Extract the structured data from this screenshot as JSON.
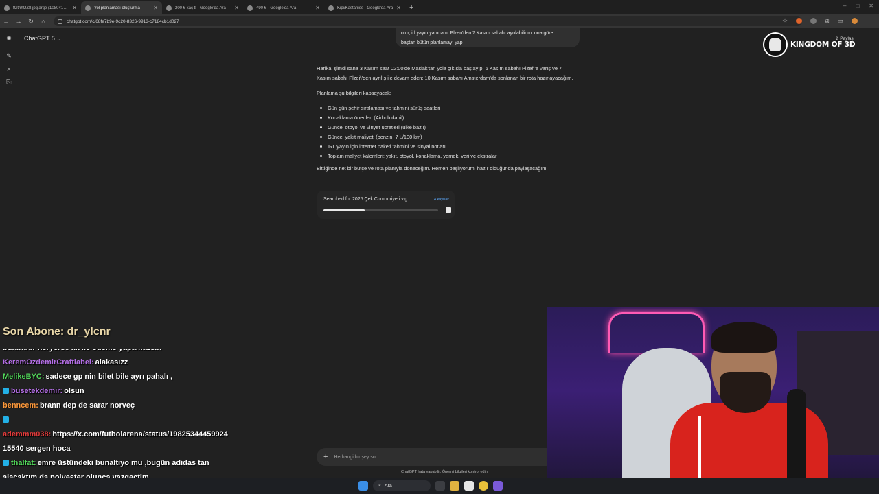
{
  "browser": {
    "tabs": [
      {
        "label": "fGthhOZ8.jpglarge (1080×1350)",
        "active": false
      },
      {
        "label": "Yol planlaması oluşturma",
        "active": true
      },
      {
        "label": "200 € kaç tl - Google'da Ara",
        "active": false
      },
      {
        "label": "490 € - Google'da Ara",
        "active": false
      },
      {
        "label": "Kipi/Kastanies - Google'da Ara",
        "active": false
      }
    ],
    "url": "chatgpt.com/c/68fe7b9e-9c20-8326-9913-c7184cb1d027"
  },
  "app": {
    "model_label": "ChatGPT 5",
    "share_label": "Paylaş",
    "user_message": [
      "olur, irl yayın yapıcam. Plzen'den 7 Kasım sabahı ayrılabilirim. ona göre",
      "baştan bütün planlamayı yap"
    ],
    "reply": {
      "intro": "Harika, şimdi sana 3 Kasım saat 02:00'de Maslak'tan yola çıkışla başlayıp, 6 Kasım sabahı Plzeň'e varış ve 7 Kasım sabahı Plzeň'den ayrılış ile devam eden; 10 Kasım sabahı Amsterdam'da sonlanan bir rota hazırlayacağım.",
      "scope_heading": "Planlama şu bilgileri kapsayacak:",
      "items": [
        "Gün gün şehir sıralaması ve tahmini sürüş saatleri",
        "Konaklama önerileri (Airbnb dahil)",
        "Güncel otoyol ve vinyet ücretleri (ülke bazlı)",
        "Güncel yakıt maliyeti (benzin, 7 L/100 km)",
        "IRL yayın için internet paketi tahmini ve sinyal notları",
        "Toplam maliyet kalemleri: yakıt, otoyol, konaklama, yemek, veri ve ekstralar"
      ],
      "closing": "Bittiğinde net bir bütçe ve rota planıyla döneceğim. Hemen başlıyorum, hazır olduğunda paylaşacağım."
    },
    "search_status": {
      "text": "Searched for 2025 Çek Cumhuriyeti vig...",
      "sources": "4 kaynak",
      "progress": 0.36
    },
    "composer_placeholder": "Herhangi bir şey sor",
    "disclaimer": "ChatGPT hata yapabilir. Önemli bilgileri kontrol edin."
  },
  "overlay": {
    "logo_text": "KINGDOM OF 3D",
    "last_sub": "Son Abone: dr_ylcnr",
    "chat": [
      {
        "user": "",
        "message": "bulundur heryerse kk ile ödeme yapamazsın",
        "color": "#ffffff",
        "cut": true,
        "badge": false
      },
      {
        "user": "KeremOzdemirCraftlabel:",
        "message": "alakasızz",
        "color": "#b46ee6",
        "badge": false
      },
      {
        "user": "MelikeBYC:",
        "message": "sadece gp nin bilet bile ayrı pahalı ,",
        "color": "#52d65a",
        "badge": false
      },
      {
        "user": "busetekdemir:",
        "message": "olsun",
        "color": "#b46ee6",
        "badge": true
      },
      {
        "user": "benncem:",
        "message": "brann dep de sarar norveç",
        "color": "#ff9a3c",
        "badge": false
      },
      {
        "user": "",
        "message": "",
        "color": "#ffffff",
        "badge": true
      },
      {
        "user": "ademmm038:",
        "message": "https://x.com/futbolarena/status/19825344459924",
        "color": "#e23a3a",
        "badge": false
      },
      {
        "user": "",
        "message": "15540 sergen hoca",
        "color": "#ffffff",
        "badge": false
      },
      {
        "user": "thalfat:",
        "message": "emre üstündeki bunaltıyo mu ,bugün adidas tan",
        "color": "#52d65a",
        "badge": true
      },
      {
        "user": "",
        "message": "alacaktım da polyester olunca vazgeçtim",
        "color": "#ffffff",
        "badge": false
      }
    ]
  },
  "taskbar": {
    "search_label": "Ara"
  },
  "colors": {
    "background": "#212121",
    "link": "#5aa2f0",
    "accent_neon": "#ff5ab4"
  }
}
